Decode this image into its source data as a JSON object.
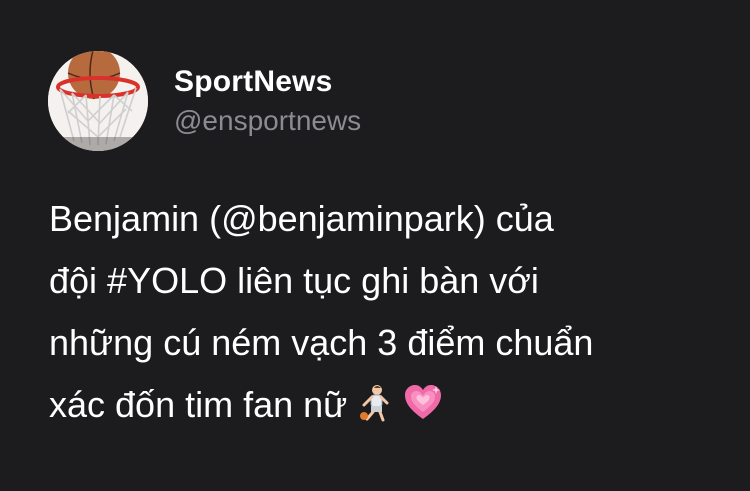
{
  "account": {
    "display_name": "SportNews",
    "handle": "@ensportnews",
    "avatar_icon": "basketball-hoop-icon"
  },
  "tweet": {
    "lines": [
      "Benjamin (@benjaminpark) của",
      "đội #YOLO liên tục ghi bàn với",
      "những cú ném vạch 3 điểm chuẩn",
      "xác đốn tim fan nữ"
    ],
    "emojis": [
      "basketball-player-icon",
      "sparkling-heart-icon"
    ]
  },
  "colors": {
    "background": "#1c1b1e",
    "text": "#ffffff",
    "handle": "#8b8b91",
    "heart": "#f06aa8"
  }
}
